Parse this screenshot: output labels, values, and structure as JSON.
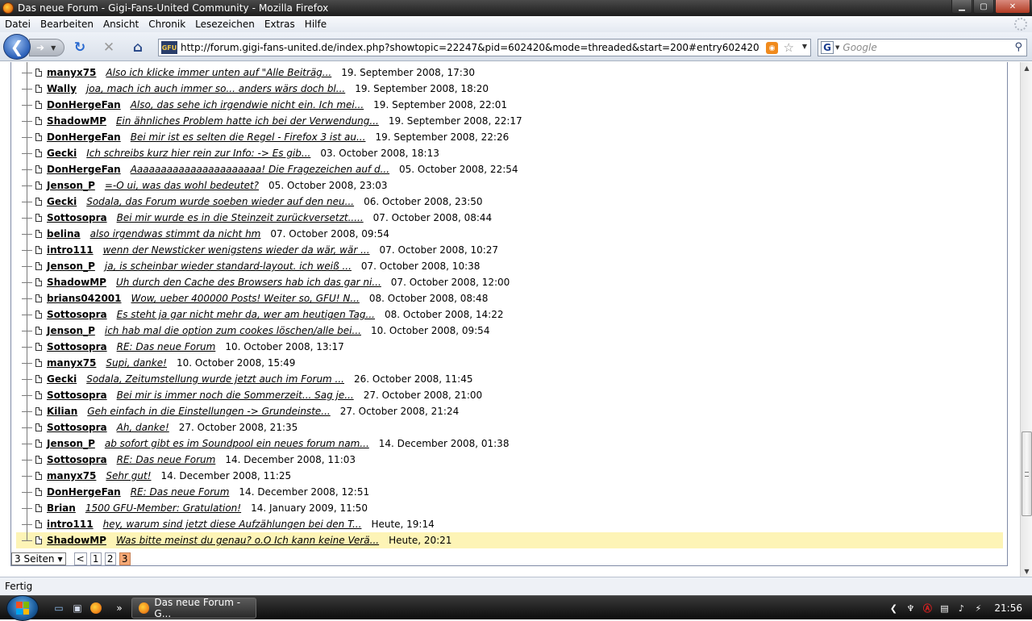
{
  "window": {
    "title": "Das neue Forum - Gigi-Fans-United Community - Mozilla Firefox"
  },
  "menu": {
    "items": [
      "Datei",
      "Bearbeiten",
      "Ansicht",
      "Chronik",
      "Lesezeichen",
      "Extras",
      "Hilfe"
    ]
  },
  "toolbar": {
    "url": "http://forum.gigi-fans-united.de/index.php?showtopic=22247&pid=602420&mode=threaded&start=200#entry602420",
    "site_icon_text": "GFU",
    "search_placeholder": "Google",
    "search_engine_letter": "G"
  },
  "posts": [
    {
      "author": "manyx75",
      "subject": "Also ich klicke immer unten auf \"Alle Beiträg...",
      "date": "19. September 2008, 17:30"
    },
    {
      "author": "Wally",
      "subject": "joa, mach ich auch immer so... anders wärs doch bl...",
      "date": "19. September 2008, 18:20"
    },
    {
      "author": "DonHergeFan",
      "subject": "Also, das sehe ich irgendwie nicht ein. Ich mei...",
      "date": "19. September 2008, 22:01"
    },
    {
      "author": "ShadowMP",
      "subject": "Ein ähnliches Problem hatte ich bei der Verwendung...",
      "date": "19. September 2008, 22:17"
    },
    {
      "author": "DonHergeFan",
      "subject": "Bei mir ist es selten die Regel - Firefox 3 ist au...",
      "date": "19. September 2008, 22:26"
    },
    {
      "author": "Gecki",
      "subject": "Ich schreibs kurz hier rein zur Info: -> Es gib...",
      "date": "03. October 2008, 18:13"
    },
    {
      "author": "DonHergeFan",
      "subject": "Aaaaaaaaaaaaaaaaaaaaaa! Die Fragezeichen auf d...",
      "date": "05. October 2008, 22:54"
    },
    {
      "author": "Jenson_P",
      "subject": "=-O ui, was das wohl bedeutet?",
      "date": "05. October 2008, 23:03"
    },
    {
      "author": "Gecki",
      "subject": "Sodala, das Forum wurde soeben wieder auf den neu...",
      "date": "06. October 2008, 23:50"
    },
    {
      "author": "Sottosopra",
      "subject": "Bei mir wurde es in die Steinzeit zurückversetzt.....",
      "date": "07. October 2008, 08:44"
    },
    {
      "author": "belina",
      "subject": "also irgendwas stimmt da nicht hm",
      "date": "07. October 2008, 09:54"
    },
    {
      "author": "intro111",
      "subject": "wenn der Newsticker wenigstens wieder da wär, wär ...",
      "date": "07. October 2008, 10:27"
    },
    {
      "author": "Jenson_P",
      "subject": "ja, is scheinbar wieder standard-layout. ich weiß ...",
      "date": "07. October 2008, 10:38"
    },
    {
      "author": "ShadowMP",
      "subject": "Uh durch den Cache des Browsers hab ich das gar ni...",
      "date": "07. October 2008, 12:00"
    },
    {
      "author": "brians042001",
      "subject": "Wow, ueber 400000 Posts! Weiter so, GFU! N...",
      "date": "08. October 2008, 08:48"
    },
    {
      "author": "Sottosopra",
      "subject": "Es steht ja gar nicht mehr da, wer am heutigen Tag...",
      "date": "08. October 2008, 14:22"
    },
    {
      "author": "Jenson_P",
      "subject": "ich hab mal die option zum cookes löschen/alle bei...",
      "date": "10. October 2008, 09:54"
    },
    {
      "author": "Sottosopra",
      "subject": "RE: Das neue Forum",
      "date": "10. October 2008, 13:17"
    },
    {
      "author": "manyx75",
      "subject": "Supi, danke!",
      "date": "10. October 2008, 15:49"
    },
    {
      "author": "Gecki",
      "subject": "Sodala, Zeitumstellung wurde jetzt auch im Forum ...",
      "date": "26. October 2008, 11:45"
    },
    {
      "author": "Sottosopra",
      "subject": "Bei mir is immer noch die Sommerzeit... Sag je...",
      "date": "27. October 2008, 21:00"
    },
    {
      "author": "Kilian",
      "subject": "Geh einfach in die Einstellungen -> Grundeinste...",
      "date": "27. October 2008, 21:24"
    },
    {
      "author": "Sottosopra",
      "subject": "Ah, danke!",
      "date": "27. October 2008, 21:35"
    },
    {
      "author": "Jenson_P",
      "subject": "ab sofort gibt es im Soundpool ein neues forum nam...",
      "date": "14. December 2008, 01:38"
    },
    {
      "author": "Sottosopra",
      "subject": "RE: Das neue Forum",
      "date": "14. December 2008, 11:03"
    },
    {
      "author": "manyx75",
      "subject": "Sehr gut!",
      "date": "14. December 2008, 11:25"
    },
    {
      "author": "DonHergeFan",
      "subject": "RE: Das neue Forum",
      "date": "14. December 2008, 12:51"
    },
    {
      "author": "Brian",
      "subject": "1500 GFU-Member: Gratulation!",
      "date": "14. January 2009, 11:50"
    },
    {
      "author": "intro111",
      "subject": "hey, warum sind jetzt diese Aufzählungen bei den T...",
      "date": "Heute, 19:14"
    },
    {
      "author": "ShadowMP",
      "subject": "Was bitte meinst du genau? o.O Ich kann keine Verä...",
      "date": "Heute, 20:21",
      "active": true
    }
  ],
  "pager": {
    "select_label": "3 Seiten",
    "prev_label": "<",
    "pages": [
      "1",
      "2",
      "3"
    ],
    "current_page": "3"
  },
  "statusbar": {
    "text": "Fertig"
  },
  "taskbar": {
    "task_label": "Das neue Forum - G...",
    "clock": "21:56",
    "overflow_glyph": "»"
  },
  "colors": {
    "active_row": "#fdf4b6",
    "current_page": "#f6a875",
    "box_border": "#7f8aa6"
  }
}
